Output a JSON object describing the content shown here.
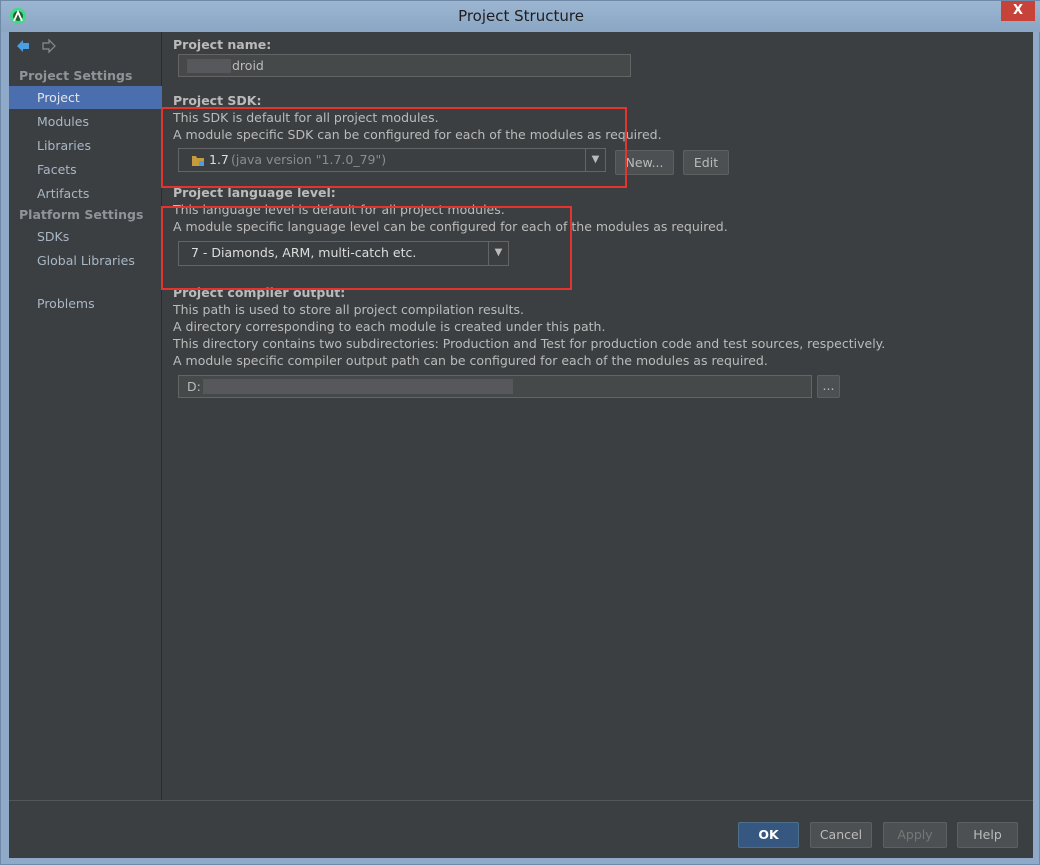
{
  "window": {
    "title": "Project Structure",
    "close_glyph": "X"
  },
  "sidebar": {
    "project_settings_header": "Project Settings",
    "project_items": [
      "Project",
      "Modules",
      "Libraries",
      "Facets",
      "Artifacts"
    ],
    "platform_settings_header": "Platform Settings",
    "platform_items": [
      "SDKs",
      "Global Libraries"
    ],
    "problems": "Problems",
    "selected": "Project"
  },
  "main": {
    "project_name_label": "Project name:",
    "project_name_value": "droid",
    "sdk_label": "Project SDK:",
    "sdk_desc_1": "This SDK is default for all project modules.",
    "sdk_desc_2": "A module specific SDK can be configured for each of the modules as required.",
    "sdk_value": "1.7",
    "sdk_value_detail": "(java version \"1.7.0_79\")",
    "sdk_new_button": "New...",
    "sdk_edit_button": "Edit",
    "lang_label": "Project language level:",
    "lang_desc_1": "This language level is default for all project modules.",
    "lang_desc_2": "A module specific language level can be configured for each of the modules as required.",
    "lang_value": "7 - Diamonds, ARM, multi-catch etc.",
    "output_label": "Project compiler output:",
    "output_desc_1": "This path is used to store all project compilation results.",
    "output_desc_2": "A directory corresponding to each module is created under this path.",
    "output_desc_3": "This directory contains two subdirectories: Production and Test for production code and test sources, respectively.",
    "output_desc_4": "A module specific compiler output path can be configured for each of the modules as required.",
    "output_value": "D:",
    "browse_button": "..."
  },
  "footer": {
    "ok": "OK",
    "cancel": "Cancel",
    "apply": "Apply",
    "help": "Help"
  },
  "colors": {
    "selection": "#4b6eaf",
    "annotation_red": "#e5332e",
    "background": "#3c3f41"
  }
}
